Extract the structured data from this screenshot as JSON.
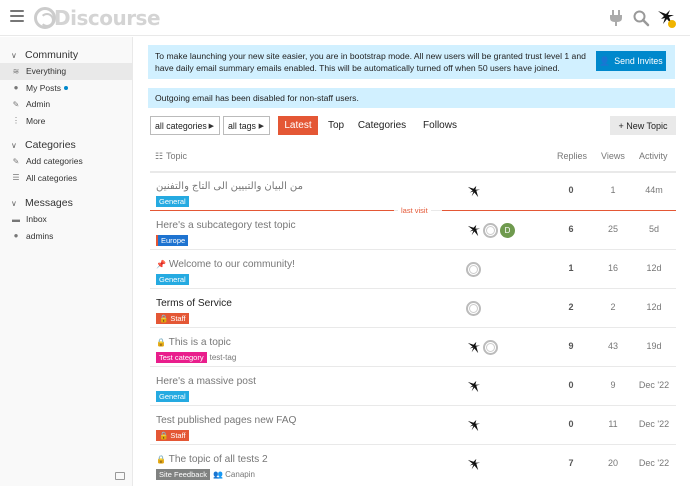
{
  "header": {
    "logo_text": "Discourse"
  },
  "sidebar": {
    "community": {
      "title": "Community",
      "items": [
        {
          "label": "Everything",
          "icon": "layers-icon"
        },
        {
          "label": "My Posts",
          "icon": "user-icon"
        },
        {
          "label": "Admin",
          "icon": "wrench-icon"
        },
        {
          "label": "More",
          "icon": "ellipsis-icon"
        }
      ]
    },
    "categories": {
      "title": "Categories",
      "items": [
        {
          "label": "Add categories",
          "icon": "pencil-icon"
        },
        {
          "label": "All categories",
          "icon": "list-icon"
        }
      ]
    },
    "messages": {
      "title": "Messages",
      "items": [
        {
          "label": "Inbox",
          "icon": "inbox-icon"
        },
        {
          "label": "admins",
          "icon": "group-icon"
        }
      ]
    }
  },
  "banner_bootstrap": {
    "text": "To make launching your new site easier, you are in bootstrap mode. All new users will be granted trust level 1 and have daily email summary emails enabled. This will be automatically turned off when 50 users have joined.",
    "button": "Send Invites"
  },
  "banner_email": {
    "text": "Outgoing email has been disabled for non-staff users."
  },
  "nav": {
    "categories_dd": "all categories",
    "tags_dd": "all tags",
    "latest": "Latest",
    "top": "Top",
    "categories": "Categories",
    "follows": "Follows",
    "new_topic": "New Topic"
  },
  "table": {
    "headers": {
      "topic": "Topic",
      "replies": "Replies",
      "views": "Views",
      "activity": "Activity"
    },
    "last_visit": "last visit",
    "rows": [
      {
        "title": "من البيان والتبيين الى التاج والتفنين",
        "category": "General",
        "category_color": "#25aae1",
        "replies": "0",
        "views": "1",
        "activity": "44m"
      },
      {
        "title": "Here's a subcategory test topic",
        "category": "Europe",
        "category_color": "#1e73d0",
        "replies": "6",
        "views": "25",
        "activity": "5d",
        "poster_letter": "D"
      },
      {
        "title": "Welcome to our community!",
        "category": "General",
        "category_color": "#25aae1",
        "replies": "1",
        "views": "16",
        "activity": "12d"
      },
      {
        "title": "Terms of Service",
        "category": "Staff",
        "category_color": "#e45735",
        "replies": "2",
        "views": "2",
        "activity": "12d"
      },
      {
        "title": "This is a topic",
        "category": "Test category",
        "category_color": "#e91e8c",
        "tag": "test-tag",
        "replies": "9",
        "views": "43",
        "activity": "19d"
      },
      {
        "title": "Here's a massive post",
        "category": "General",
        "category_color": "#25aae1",
        "replies": "0",
        "views": "9",
        "activity": "Dec '22"
      },
      {
        "title": "Test published pages new FAQ",
        "category": "Staff",
        "category_color": "#e45735",
        "replies": "0",
        "views": "11",
        "activity": "Dec '22"
      },
      {
        "title": "The topic of all tests 2",
        "category": "Site Feedback",
        "category_color": "#808281",
        "group": "Canapin",
        "replies": "7",
        "views": "20",
        "activity": "Dec '22"
      }
    ]
  }
}
